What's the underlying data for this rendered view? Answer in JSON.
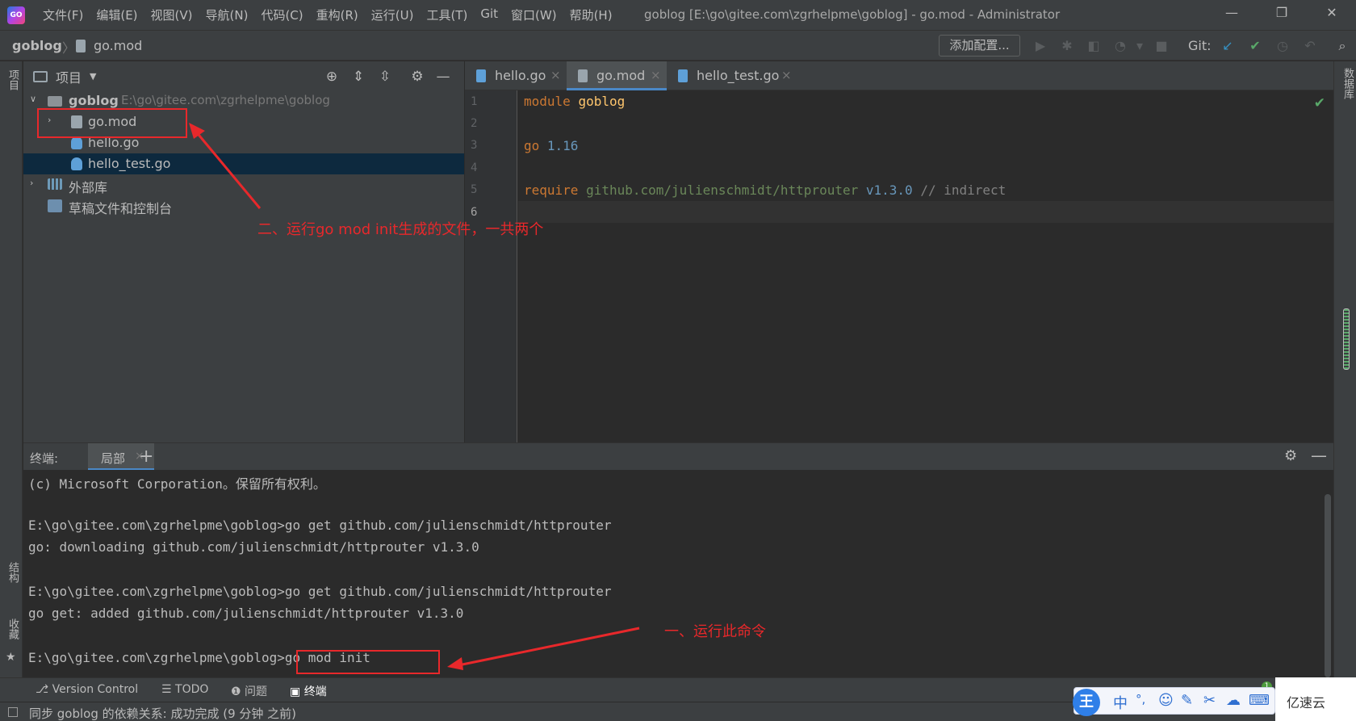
{
  "window": {
    "logo_text": "GO",
    "menu": [
      "文件(F)",
      "编辑(E)",
      "视图(V)",
      "导航(N)",
      "代码(C)",
      "重构(R)",
      "运行(U)",
      "工具(T)",
      "Git",
      "窗口(W)",
      "帮助(H)"
    ],
    "title": "goblog [E:\\go\\gitee.com\\zgrhelpme\\goblog] - go.mod - Administrator"
  },
  "navbar": {
    "project": "goblog",
    "file": "go.mod",
    "add_config": "添加配置...",
    "git_label": "Git:"
  },
  "left_stripe": {
    "project": "项目",
    "structure": "结构",
    "favorites": "收藏"
  },
  "right_stripe": {
    "database": "数据库"
  },
  "project_panel": {
    "title": "项目",
    "tree": {
      "root_name": "goblog",
      "root_path": "E:\\go\\gitee.com\\zgrhelpme\\goblog",
      "items": [
        "go.mod",
        "hello.go",
        "hello_test.go"
      ],
      "external_libs": "外部库",
      "scratches": "草稿文件和控制台"
    }
  },
  "annotations": {
    "files_note": "二、运行go mod init生成的文件，一共两个",
    "command_note": "一、运行此命令"
  },
  "editor": {
    "tabs": [
      "hello.go",
      "go.mod",
      "hello_test.go"
    ],
    "active_tab": "go.mod",
    "line_numbers": [
      "1",
      "2",
      "3",
      "4",
      "5",
      "6"
    ],
    "code": {
      "l1_kw": "module",
      "l1_name": "goblog",
      "l3_kw": "go",
      "l3_ver": "1.16",
      "l5_kw": "require",
      "l5_path": "github.com/julienschmidt/httprouter",
      "l5_ver": "v1.3.0",
      "l5_comment": "// indirect"
    }
  },
  "terminal": {
    "title": "终端:",
    "tab": "局部",
    "lines": [
      "(c) Microsoft Corporation。保留所有权利。",
      "",
      "E:\\go\\gitee.com\\zgrhelpme\\goblog>go get github.com/julienschmidt/httprouter",
      "go: downloading github.com/julienschmidt/httprouter v1.3.0",
      "",
      "E:\\go\\gitee.com\\zgrhelpme\\goblog>go get github.com/julienschmidt/httprouter",
      "go get: added github.com/julienschmidt/httprouter v1.3.0",
      "",
      "E:\\go\\gitee.com\\zgrhelpme\\goblog>go mod init"
    ]
  },
  "tool_strip": [
    "Version Control",
    "TODO",
    "问题",
    "终端"
  ],
  "status_bar": {
    "text": "同步 goblog 的依赖关系: 成功完成 (9 分钟 之前)"
  },
  "git_notification_count": "1",
  "ime": {
    "logo": "王",
    "items": [
      "中",
      "°,",
      "☺",
      "✎",
      "✂",
      "☁",
      "⌨"
    ]
  },
  "watermark": "亿速云",
  "colors": {
    "accent": "#4a88c7",
    "annotation_red": "#e8282b",
    "selection": "#0d293e"
  }
}
